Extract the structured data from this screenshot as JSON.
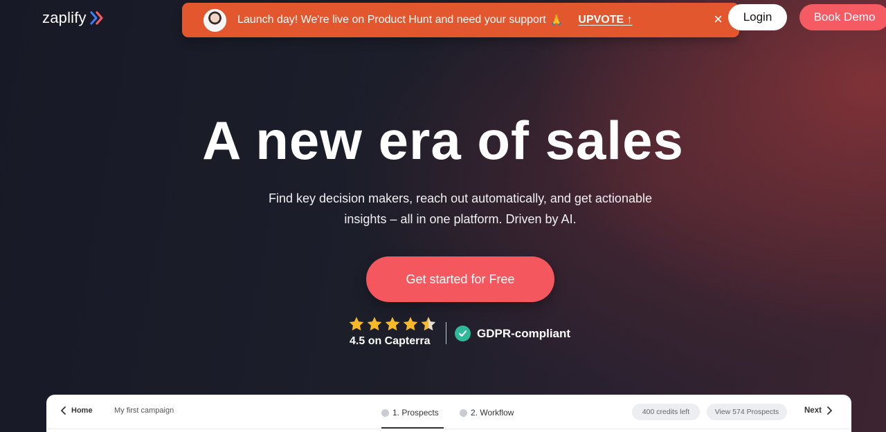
{
  "brand": {
    "name": "zaplify",
    "accent": "#f45b62",
    "banner_color": "#e2572e"
  },
  "banner": {
    "message": "Launch day! We're live on Product Hunt and need your support",
    "emoji": "🙏",
    "upvote_label": "UPVOTE ↑",
    "close_icon": "×"
  },
  "nav": {
    "login_label": "Login",
    "book_demo_label": "Book Demo"
  },
  "hero": {
    "title": "A new era of sales",
    "subtitle_line1": "Find key decision makers, reach out automatically, and get actionable",
    "subtitle_line2": "insights – all in one platform. Driven by AI.",
    "cta_label": "Get started for Free"
  },
  "trust": {
    "rating_stars": 4.5,
    "rating_text": "4.5 on Capterra",
    "gdpr_text": "GDPR-compliant"
  },
  "app_preview": {
    "home_label": "Home",
    "campaign_name": "My first campaign",
    "step1_label": "1. Prospects",
    "step2_label": "2. Workflow",
    "credits_label": "400 credits left",
    "view_prospects_label": "View 574 Prospects",
    "next_label": "Next"
  }
}
